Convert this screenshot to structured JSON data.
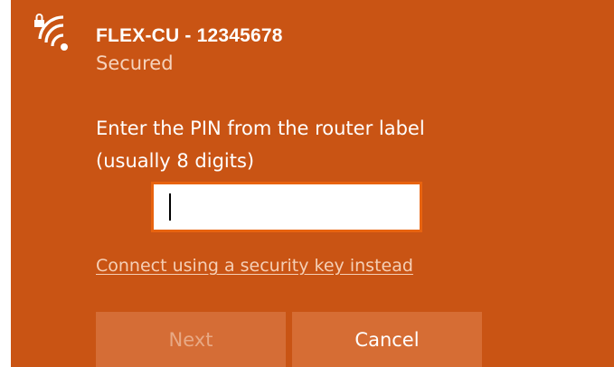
{
  "network": {
    "name": "FLEX-CU - 12345678",
    "status": "Secured",
    "icon": "wifi-secured-icon"
  },
  "pin_dialog": {
    "prompt": "Enter the PIN from the router label\n(usually 8 digits)",
    "pin_value": "",
    "alt_link": "Connect using a security key instead"
  },
  "buttons": {
    "next_label": "Next",
    "next_enabled": false,
    "cancel_label": "Cancel"
  },
  "colors": {
    "accent_background": "#c95414",
    "input_border": "#e8630f",
    "button_background": "#d66d34"
  }
}
